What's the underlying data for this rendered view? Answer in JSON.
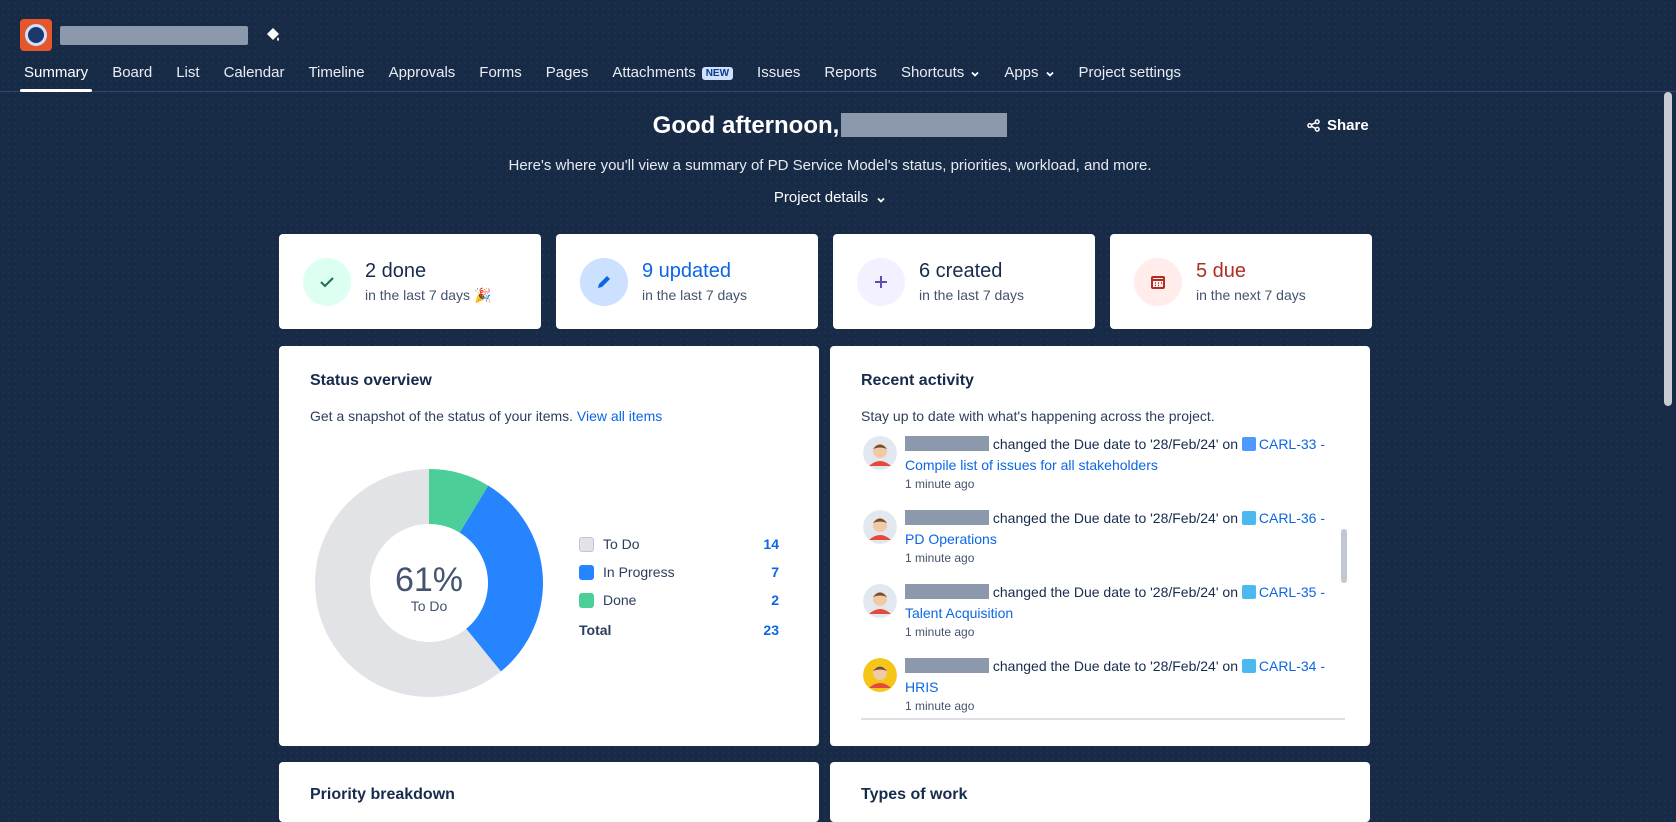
{
  "header": {
    "tabs": [
      {
        "label": "Summary",
        "active": true
      },
      {
        "label": "Board"
      },
      {
        "label": "List"
      },
      {
        "label": "Calendar"
      },
      {
        "label": "Timeline"
      },
      {
        "label": "Approvals"
      },
      {
        "label": "Forms"
      },
      {
        "label": "Pages"
      },
      {
        "label": "Attachments",
        "badge": "NEW"
      },
      {
        "label": "Issues"
      },
      {
        "label": "Reports"
      },
      {
        "label": "Shortcuts",
        "dropdown": true
      },
      {
        "label": "Apps",
        "dropdown": true
      },
      {
        "label": "Project settings"
      }
    ]
  },
  "greeting": {
    "text": "Good afternoon,",
    "subtitle": "Here's where you'll view a summary of PD Service Model's status, priorities, workload, and more.",
    "project_details": "Project details",
    "share": "Share"
  },
  "stats": [
    {
      "big": "2 done",
      "small": "in the last 7 days 🎉",
      "color": "#172b4d",
      "circle": "#dcfff1",
      "icon": "check-icon"
    },
    {
      "big": "9 updated",
      "small": "in the last 7 days",
      "color": "#0c66e4",
      "circle": "#cce0ff",
      "icon": "pencil-icon"
    },
    {
      "big": "6 created",
      "small": "in the last 7 days",
      "color": "#172b4d",
      "circle": "#f3f0ff",
      "icon": "plus-icon"
    },
    {
      "big": "5 due",
      "small": "in the next 7 days",
      "color": "#ae2e24",
      "circle": "#ffeceb",
      "icon": "calendar-icon"
    }
  ],
  "status_overview": {
    "title": "Status overview",
    "desc": "Get a snapshot of the status of your items.",
    "link": "View all items",
    "center_pct": "61%",
    "center_label": "To Do",
    "total_label": "Total",
    "total": "23"
  },
  "chart_data": {
    "type": "pie",
    "categories": [
      "To Do",
      "In Progress",
      "Done"
    ],
    "values": [
      14,
      7,
      2
    ],
    "colors": [
      "#e2e3e6",
      "#2684ff",
      "#4bce97"
    ]
  },
  "recent_activity": {
    "title": "Recent activity",
    "desc": "Stay up to date with what's happening across the project.",
    "items": [
      {
        "action": "changed the Due date to '28/Feb/24' on",
        "item": "CARL-33 - Compile list of issues for all stakeholders",
        "time": "1 minute ago",
        "icon_color": "#4c9aff",
        "avatar_bg": "#e2e8f0",
        "icon": "checkbox-icon"
      },
      {
        "action": "changed the Due date to '28/Feb/24' on",
        "item": "CARL-36 - PD Operations",
        "time": "1 minute ago",
        "icon_color": "#4bb8f0",
        "avatar_bg": "#e2e8f0",
        "icon": "subtask-icon"
      },
      {
        "action": "changed the Due date to '28/Feb/24' on",
        "item": "CARL-35 - Talent Acquisition",
        "time": "1 minute ago",
        "icon_color": "#4bb8f0",
        "avatar_bg": "#e2e8f0",
        "icon": "subtask-icon"
      },
      {
        "action": "changed the Due date to '28/Feb/24' on",
        "item": "CARL-34 - HRIS",
        "time": "1 minute ago",
        "icon_color": "#4bb8f0",
        "avatar_bg": "#f5c518",
        "icon": "subtask-icon"
      }
    ]
  },
  "bottom_panels": {
    "left_title": "Priority breakdown",
    "right_title": "Types of work"
  }
}
